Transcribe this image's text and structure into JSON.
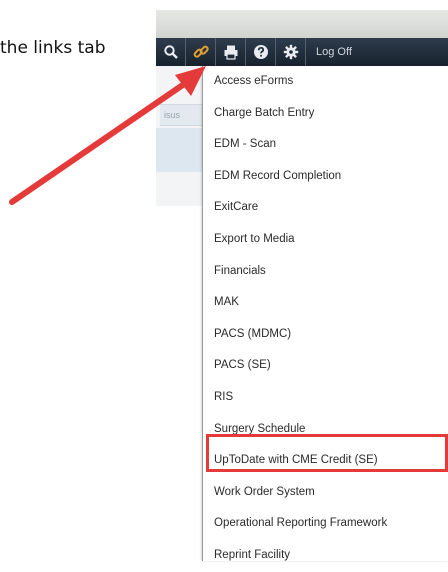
{
  "caption": "the links tab",
  "toolbar": {
    "buttons": [
      {
        "icon": "search-icon"
      },
      {
        "icon": "link-icon"
      },
      {
        "icon": "print-icon"
      },
      {
        "icon": "help-icon"
      },
      {
        "icon": "gear-icon"
      }
    ],
    "logoff_label": "Log Off"
  },
  "background": {
    "faded_text": "isus"
  },
  "menu": {
    "items": [
      "Access eForms",
      "Charge Batch Entry",
      "EDM - Scan",
      "EDM Record Completion",
      "ExitCare",
      "Export to Media",
      "Financials",
      "MAK",
      "PACS (MDMC)",
      "PACS (SE)",
      "RIS",
      "Surgery Schedule",
      "UpToDate with CME Credit (SE)",
      "Work Order System",
      "Operational Reporting Framework",
      "Reprint Facility"
    ],
    "highlighted_item": "UpToDate with CME Credit (SE)"
  },
  "colors": {
    "annotation": "#e53a3a",
    "toolbar": "#1f2b38",
    "link_icon": "#e0a030"
  }
}
